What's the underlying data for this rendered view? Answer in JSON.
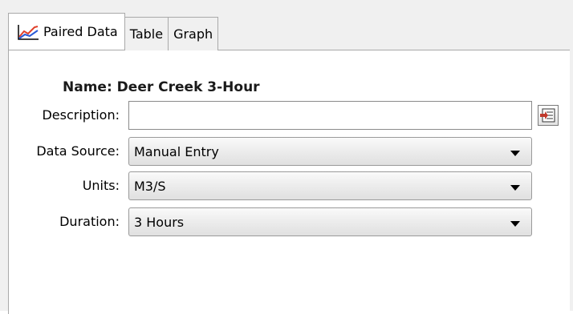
{
  "tabs": [
    {
      "label": "Paired Data",
      "icon": "paired-data-chart-icon",
      "active": true
    },
    {
      "label": "Table",
      "active": false
    },
    {
      "label": "Graph",
      "active": false
    }
  ],
  "name": {
    "label": "Name:",
    "value": "Deer Creek 3-Hour"
  },
  "description": {
    "label": "Description:",
    "value": "",
    "button_icon": "edit-description-icon"
  },
  "data_source": {
    "label": "Data Source:",
    "value": "Manual Entry"
  },
  "units": {
    "label": "Units:",
    "value": "M3/S"
  },
  "duration": {
    "label": "Duration:",
    "value": "3 Hours"
  },
  "colors": {
    "chart_icon_red": "#e0402a",
    "chart_icon_blue": "#2a5bd7",
    "button_icon_red": "#c0392b"
  }
}
